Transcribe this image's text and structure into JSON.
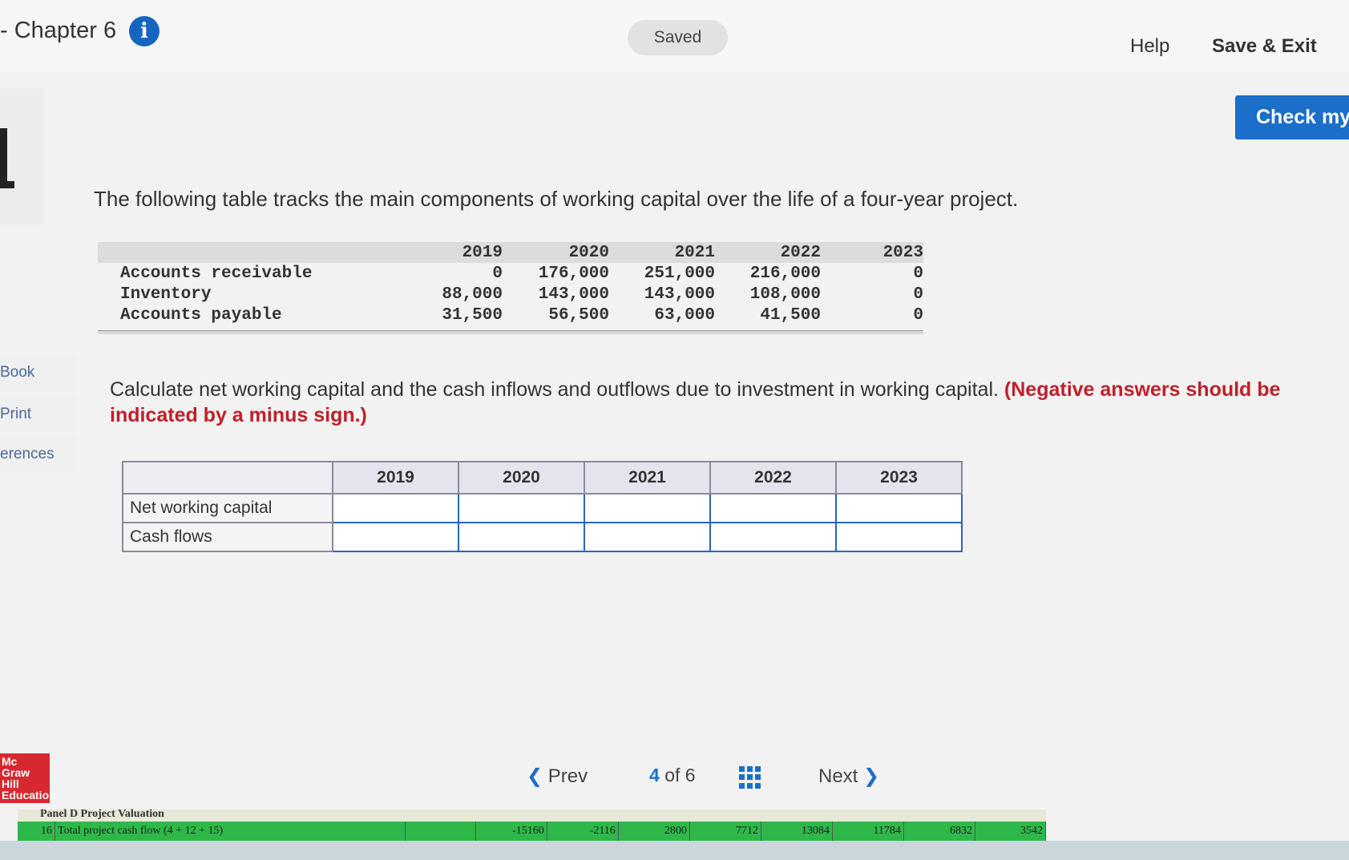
{
  "header": {
    "chapter_title": "- Chapter 6",
    "saved_label": "Saved",
    "help_label": "Help",
    "save_exit_label": "Save & Exit",
    "check_label": "Check my"
  },
  "sidebar": {
    "book_label": "Book",
    "print_label": "Print",
    "references_label": "erences"
  },
  "question": {
    "intro": "The following table tracks the main components of working capital over the life of a four-year project.",
    "given_table": {
      "years": [
        "2019",
        "2020",
        "2021",
        "2022",
        "2023"
      ],
      "rows": [
        {
          "label": "Accounts receivable",
          "values": [
            "0",
            "176,000",
            "251,000",
            "216,000",
            "0"
          ]
        },
        {
          "label": "Inventory",
          "values": [
            "88,000",
            "143,000",
            "143,000",
            "108,000",
            "0"
          ]
        },
        {
          "label": "Accounts payable",
          "values": [
            "31,500",
            "56,500",
            "63,000",
            "41,500",
            "0"
          ]
        }
      ]
    },
    "instruction": "Calculate net working capital and the cash inflows and outflows due to investment in working capital.",
    "instruction_note": "(Negative answers should be indicated by a minus sign.)"
  },
  "answer_table": {
    "years": [
      "2019",
      "2020",
      "2021",
      "2022",
      "2023"
    ],
    "rows": [
      {
        "label": "Net working capital",
        "values": [
          "",
          "",
          "",
          "",
          ""
        ]
      },
      {
        "label": "Cash flows",
        "values": [
          "",
          "",
          "",
          "",
          ""
        ]
      }
    ]
  },
  "footer": {
    "prev_label": "Prev",
    "page_current": "4",
    "page_of": "of",
    "page_total": "6",
    "next_label": "Next",
    "logo_text": "Mc Graw Hill Education"
  },
  "background_sheet": {
    "caption": "Panel D Project Valuation",
    "row_number": "16",
    "row_label": "Total project cash flow (4 + 12 + 15)",
    "values": [
      "",
      "",
      "-15160",
      "-2116",
      "2800",
      "7712",
      "13084",
      "11784",
      "6832",
      "3542"
    ]
  },
  "colors": {
    "accent_blue": "#1a6fc9",
    "note_red": "#c0202a",
    "logo_red": "#d7282f",
    "sheet_green": "#2fb84a"
  }
}
